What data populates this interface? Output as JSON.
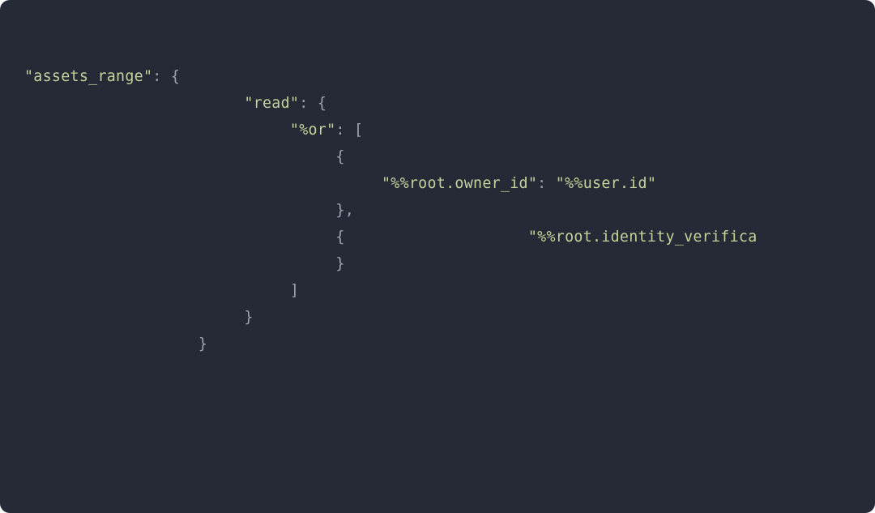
{
  "code": {
    "l1": {
      "key": "\"assets_range\"",
      "tail": ": {"
    },
    "l2": {
      "indent": "                        ",
      "key": "\"read\"",
      "tail": ": {"
    },
    "l3": {
      "indent": "                             ",
      "key": "\"%or\"",
      "tail": ": ["
    },
    "l4": {
      "indent": "                                  ",
      "text": "{"
    },
    "l5": {
      "indent": "                                       ",
      "key": "\"%%root.owner_id\"",
      "colon": ": ",
      "val": "\"%%user.id\""
    },
    "l6": {
      "indent": "                                  ",
      "text": "},"
    },
    "l7": {
      "indent": "                                  ",
      "open": "{",
      "gap": "                    ",
      "key": "\"%%root.identity_verifica"
    },
    "l8": {
      "indent": "                                  ",
      "text": "}"
    },
    "l9": {
      "indent": "                             ",
      "text": "]"
    },
    "l10": {
      "indent": "                        ",
      "text": "}"
    },
    "l11": {
      "indent": "                   ",
      "text": "}"
    }
  }
}
